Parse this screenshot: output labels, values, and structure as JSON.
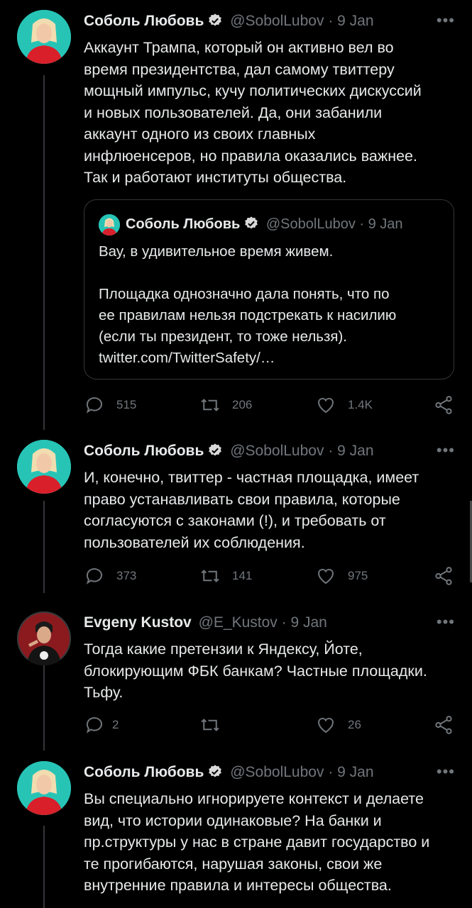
{
  "tweets": [
    {
      "name": "Соболь Любовь",
      "handle": "@SobolLubov",
      "date": "· 9 Jan",
      "text": "Аккаунт Трампа, который он активно вел во\nвремя президентства, дал самому твиттеру\nмощный импульс, кучу политических дискуссий\nи новых пользователей. Да, они забанили\nаккаунт одного из своих главных\nинфлюенсеров, но правила оказались важнее.\nТак и работают институты общества.",
      "quote": {
        "name": "Соболь Любовь",
        "handle": "@SobolLubov",
        "date": "· 9 Jan",
        "text": "Вау, в удивительное время живем.\n\nПлощадка однозначно дала понять, что по\nее правилам нельзя подстрекать к насилию\n(если ты президент, то тоже нельзя).\ntwitter.com/TwitterSafety/…"
      },
      "replies": "515",
      "retweets": "206",
      "likes": "1.4K"
    },
    {
      "name": "Соболь Любовь",
      "handle": "@SobolLubov",
      "date": "· 9 Jan",
      "text": "И, конечно, твиттер - частная площадка, имеет\nправо устанавливать свои правила, которые\nсогласуются с законами (!), и требовать от\nпользователей их соблюдения.",
      "replies": "373",
      "retweets": "141",
      "likes": "975"
    },
    {
      "name": "Evgeny Kustov",
      "handle": "@E_Kustov",
      "date": "· 9 Jan",
      "text": "Тогда какие претензии к Яндексу, Йоте,\nблокирующим ФБК банкам? Частные площадки.\nТьфу.",
      "replies": "2",
      "retweets": "",
      "likes": "26"
    },
    {
      "name": "Соболь Любовь",
      "handle": "@SobolLubov",
      "date": "· 9 Jan",
      "text": "Вы специально игнорируете контекст и делаете\nвид, что истории одинаковые? На банки и\nпр.структуры у нас в стране давит государство и\nте прогибаются, нарушая законы, свои же\nвнутренние правила и интересы общества."
    }
  ],
  "more_label": "•••",
  "colors": {
    "verified": "#d9d9d9",
    "muted": "#71767b",
    "line": "#333639"
  }
}
